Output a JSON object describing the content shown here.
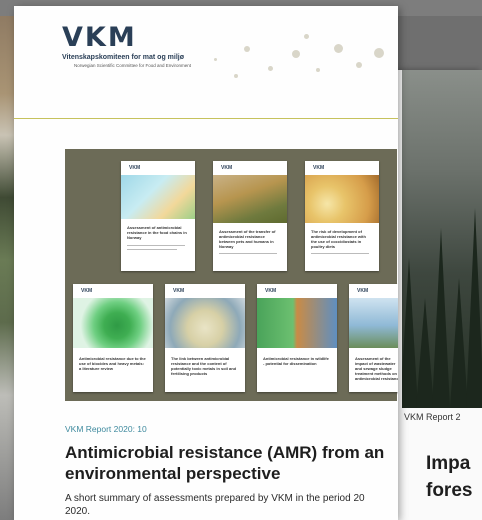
{
  "main_report": {
    "logo_text": "VKM",
    "org_name": "Vitenskapskomiteen for mat og miljø",
    "org_name_en": "Norwegian Scientific Committee for Food and Environment",
    "report_label": "VKM Report 2020: 10",
    "title": "Antimicrobial resistance (AMR) from an environmental perspective",
    "summary_line1": "A short summary of assessments prepared by VKM in the period 20",
    "summary_line2": "2020."
  },
  "cover_thumbnails": [
    {
      "logo": "VKM",
      "title": "Assessment of antimicrobial resistance in the food chains in Norway"
    },
    {
      "logo": "VKM",
      "title": "Assessment of the transfer of antimicrobial resistance between pets and humans in Norway"
    },
    {
      "logo": "VKM",
      "title": "The risk of development of antimicrobial resistance with the use of coccidiostats in poultry diets"
    },
    {
      "logo": "VKM",
      "title": "Antimicrobial resistance due to the use of biocides and heavy metals: a literature review"
    },
    {
      "logo": "VKM",
      "title": "The link between antimicrobial resistance and the content of potentially toxic metals in soil and fertilising products"
    },
    {
      "logo": "VKM",
      "title": "Antimicrobial resistance in wildlife - potential for dissemination"
    },
    {
      "logo": "VKM",
      "title": "Assessment of the impact of wastewater and sewage sludge treatment methods on antimicrobial resistance"
    }
  ],
  "second_report": {
    "report_label": "VKM Report 2",
    "title_line1": "Impa",
    "title_line2": "fores"
  }
}
